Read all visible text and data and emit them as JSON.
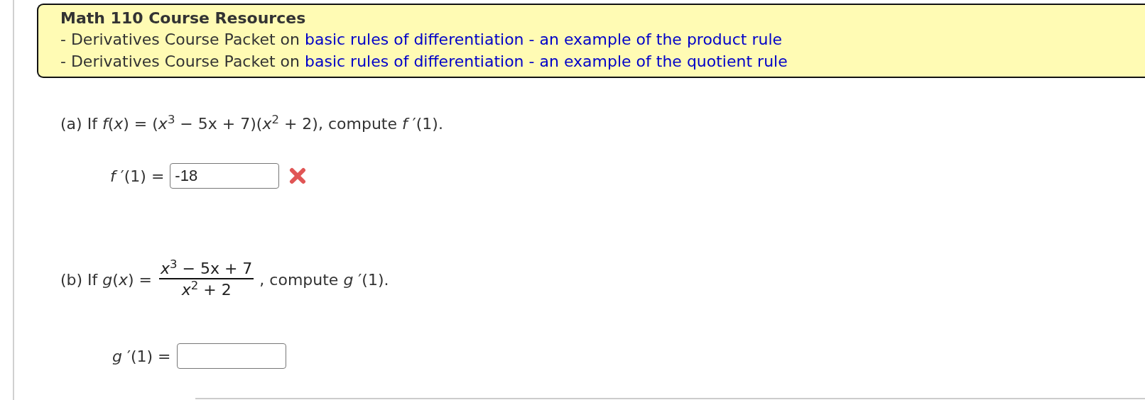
{
  "resources": {
    "title": "Math 110 Course Resources",
    "items": [
      {
        "text": "- Derivatives Course Packet on",
        "link": "basic rules of differentiation - an example of the product rule"
      },
      {
        "text": "- Derivatives Course Packet on",
        "link": "basic rules of differentiation - an example of the quotient rule"
      }
    ]
  },
  "parts": [
    {
      "kind": "inline",
      "question": "(a) If *f*(*x*) = (*x*$^{3}$ − 5x + 7)(*x*$^{2}$ + 2), compute *f* ′(1).",
      "answer_label": "*f* ′(1) =",
      "value": "-18",
      "marked_incorrect": true
    },
    {
      "kind": "fraction",
      "question_prefix": "(b) If *g*(*x*) =",
      "numerator": "*x*$^{3}$ − 5x + 7",
      "denominator": "*x*$^{2}$ + 2",
      "question_suffix": ", compute *g* ′(1).",
      "answer_label": "*g* ′(1) =",
      "marked_incorrect": false
    }
  ]
}
